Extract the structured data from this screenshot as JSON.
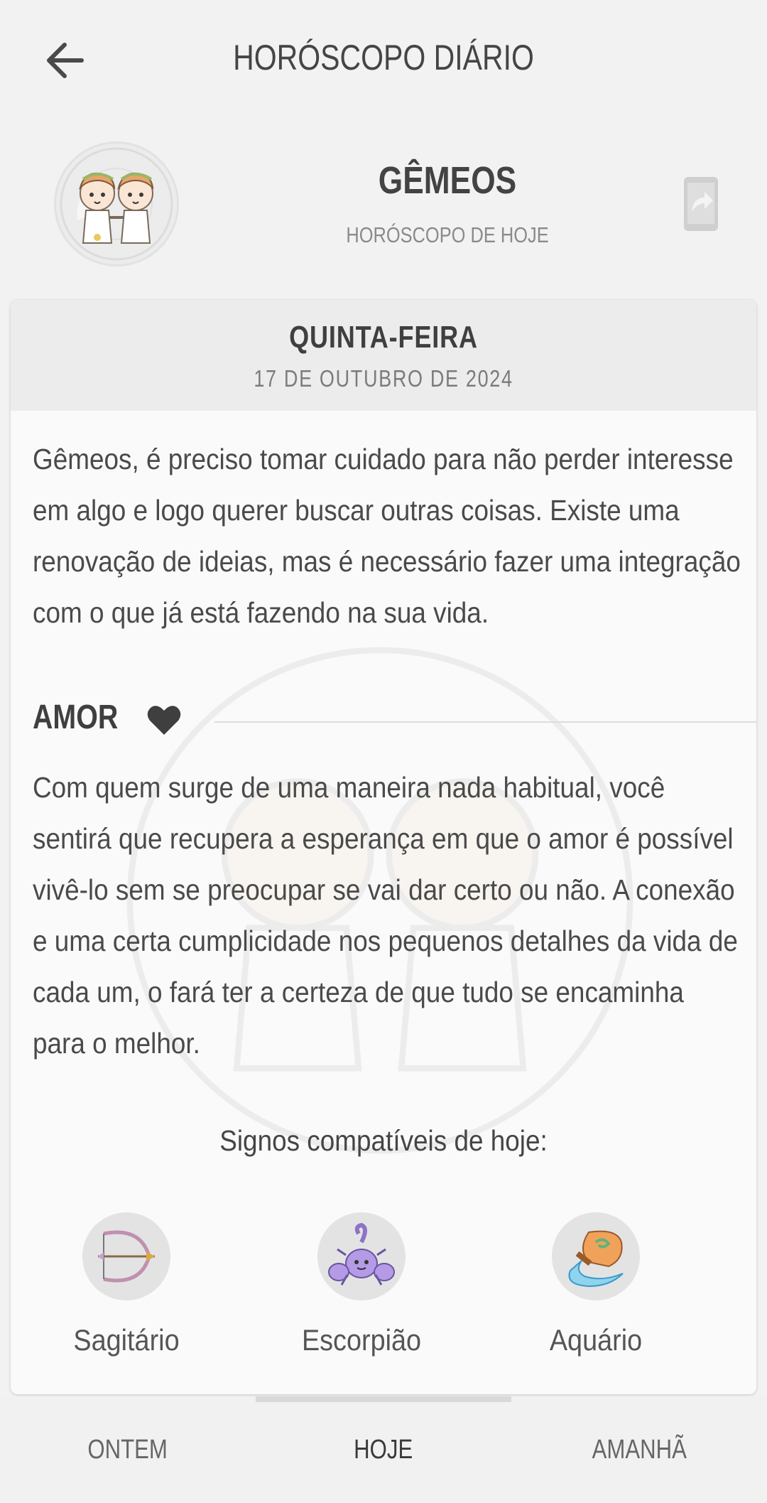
{
  "header": {
    "title": "HORÓSCOPO DIÁRIO"
  },
  "sign": {
    "name": "GÊMEOS",
    "subtitle": "HORÓSCOPO DE HOJE"
  },
  "day": {
    "weekday": "QUINTA-FEIRA",
    "date": "17 DE OUTUBRO DE 2024"
  },
  "daily_text": "Gêmeos, é preciso tomar cuidado para não perder interesse em algo e logo querer buscar outras coisas. Existe uma renovação de ideias, mas é necessário fazer uma integração com o que já está fazendo na sua vida.",
  "love": {
    "title": "AMOR",
    "text": "Com quem surge de uma maneira nada habitual, você sentirá que recupera a esperança em que o amor é possível vivê-lo sem se preocupar se vai dar certo ou não. A conexão e uma certa cumplicidade nos pequenos detalhes da vida de cada um, o fará ter a certeza de que tudo se encaminha para o melhor."
  },
  "compatible": {
    "title": "Signos compatíveis de hoje:",
    "signs": [
      {
        "label": "Sagitário",
        "icon": "sagittarius-icon"
      },
      {
        "label": "Escorpião",
        "icon": "scorpio-icon"
      },
      {
        "label": "Aquário",
        "icon": "aquarius-icon"
      }
    ]
  },
  "tabs": [
    {
      "label": "ONTEM"
    },
    {
      "label": "HOJE"
    },
    {
      "label": "AMANHÃ"
    }
  ],
  "colors": {
    "background": "#f2f2f2",
    "card": "#fafafa",
    "card_header": "#ececec",
    "text": "#3f3f3f"
  }
}
